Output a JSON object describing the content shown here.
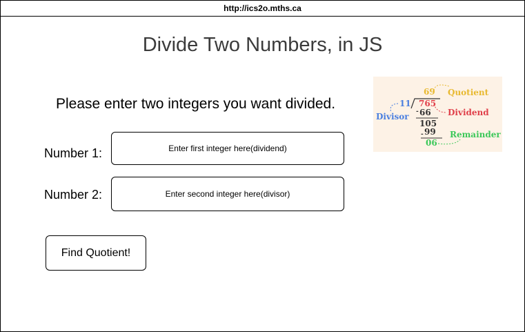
{
  "browser": {
    "url": "http://ics2o.mths.ca"
  },
  "page": {
    "title": "Divide Two Numbers, in JS",
    "instructions": "Please enter two integers you want divided."
  },
  "form": {
    "number1": {
      "label": "Number 1:",
      "value": "",
      "placeholder": "Enter first integer here(dividend)"
    },
    "number2": {
      "label": "Number 2:",
      "value": "",
      "placeholder": "Enter second integer here(divisor)"
    },
    "submit_label": "Find Quotient!"
  },
  "diagram": {
    "divisor": "11",
    "dividend": "765",
    "quotient": "69",
    "step1": "66",
    "step2": "105",
    "step3": "99",
    "remainder": "06",
    "labels": {
      "quotient": "Quotient",
      "dividend": "Dividend",
      "divisor": "Divisor",
      "remainder": "Remainder"
    },
    "colors": {
      "background": "#fdf2e6",
      "quotient": "#e8b930",
      "dividend": "#e0404a",
      "divisor": "#4a7fe0",
      "remainder": "#3cc85a",
      "working": "#333333"
    }
  }
}
